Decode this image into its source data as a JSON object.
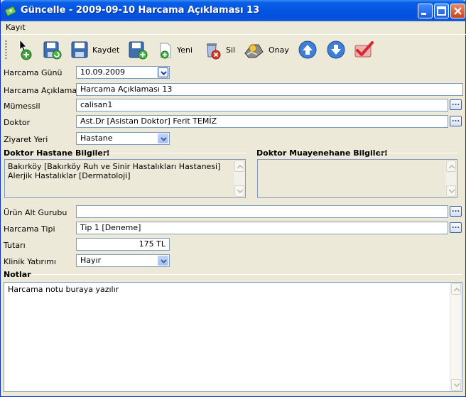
{
  "window": {
    "title": "Güncelle - 2009-09-10 Harcama Açıklaması 13"
  },
  "menu": {
    "items": [
      "Kayıt"
    ]
  },
  "toolbar": {
    "kaydet_label": "Kaydet",
    "yeni_label": "Yeni",
    "sil_label": "Sil",
    "onay_label": "Onay"
  },
  "form": {
    "harcama_gunu": {
      "label": "Harcama Günü",
      "value": "10.09.2009"
    },
    "harcama_aciklamasi": {
      "label": "Harcama Açıklaması",
      "value": "Harcama Açıklaması 13"
    },
    "mumessil": {
      "label": "Mümessil",
      "value": "calisan1"
    },
    "doktor": {
      "label": "Doktor",
      "value": "Ast.Dr [Asistan Doktor] Ferit TEMİZ"
    },
    "ziyaret_yeri": {
      "label": "Ziyaret Yeri",
      "value": "Hastane"
    },
    "doktor_hastane": {
      "title": "Doktor Hastane Bilgileri",
      "lines": [
        "Bakırköy [Bakırköy Ruh ve Sinir Hastalıkları Hastanesi]",
        "Alerjik Hastalıklar [Dermatoloji]"
      ]
    },
    "doktor_muayenehane": {
      "title": "Doktor Muayenehane Bilgileri"
    },
    "urun_alt_gurubu": {
      "label": "Ürün Alt Gurubu",
      "value": ""
    },
    "harcama_tipi": {
      "label": "Harcama Tipi",
      "value": "Tip 1 [Deneme]"
    },
    "tutari": {
      "label": "Tutarı",
      "value": "175 TL"
    },
    "klinik_yatirimi": {
      "label": "Klinik Yatırımı",
      "value": "Hayır"
    }
  },
  "notes": {
    "title": "Notlar",
    "value": "Harcama notu  buraya yazılır"
  },
  "colors": {
    "title_bar": "#0454E0",
    "window_bg": "#ECE9D8",
    "field_border": "#7F9DB9"
  }
}
